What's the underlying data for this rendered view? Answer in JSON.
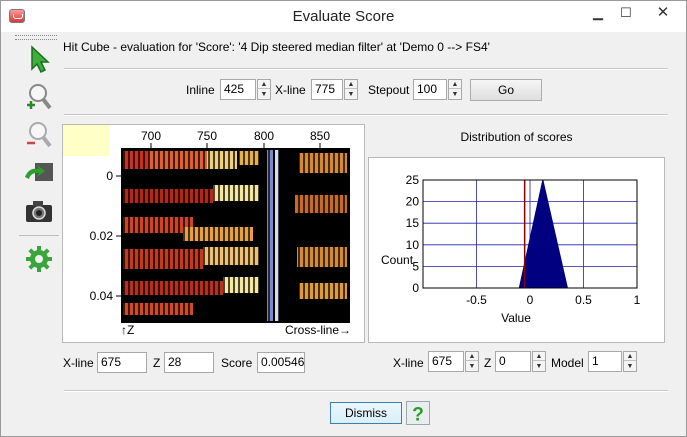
{
  "window": {
    "title": "Evaluate Score"
  },
  "toolbar": {
    "items": [
      {
        "icon": "pointer-arrow-icon"
      },
      {
        "icon": "zoom-in-icon"
      },
      {
        "icon": "zoom-out-icon"
      },
      {
        "icon": "view-home-icon"
      },
      {
        "icon": "camera-icon"
      },
      {
        "icon": "gear-icon"
      }
    ]
  },
  "info": {
    "text": "Hit Cube - evaluation for 'Score': '4 Dip steered median filter' at 'Demo 0 --> FS4'"
  },
  "position": {
    "inline_label": "Inline",
    "inline_value": "425",
    "xline_label": "X-line",
    "xline_value": "775",
    "stepout_label": "Stepout",
    "stepout_value": "100",
    "go_label": "Go"
  },
  "seismic": {
    "x_ticks": [
      "700",
      "750",
      "800",
      "850"
    ],
    "y_ticks": [
      "0",
      "0.02",
      "0.04"
    ],
    "z_axis_label": "↑Z",
    "x_axis_label": "Cross-line→"
  },
  "bottom_left": {
    "xline_label": "X-line",
    "xline_value": "675",
    "z_label": "Z",
    "z_value": "28",
    "score_label": "Score",
    "score_value": "0.00546"
  },
  "distribution": {
    "title": "Distribution of scores"
  },
  "chart_data": {
    "type": "area",
    "title": "Distribution of scores",
    "xlabel": "Value",
    "ylabel": "Count",
    "xlim": [
      -1,
      1
    ],
    "ylim": [
      0,
      25
    ],
    "x_ticks": [
      "-0.5",
      "0",
      "0.5",
      "1"
    ],
    "y_ticks": [
      "0",
      "5",
      "10",
      "15",
      "20",
      "25"
    ],
    "grid": true,
    "series": [
      {
        "x": [
          -0.1,
          0.12,
          0.35
        ],
        "values": [
          0,
          25,
          0
        ],
        "color": "#000080"
      }
    ],
    "marker_line": {
      "x": -0.05,
      "color": "#8b0000"
    }
  },
  "bottom_right": {
    "xline_label": "X-line",
    "xline_value": "675",
    "z_label": "Z",
    "z_value": "0",
    "model_label": "Model",
    "model_value": "1"
  },
  "footer": {
    "dismiss_label": "Dismiss",
    "help_symbol": "?"
  }
}
